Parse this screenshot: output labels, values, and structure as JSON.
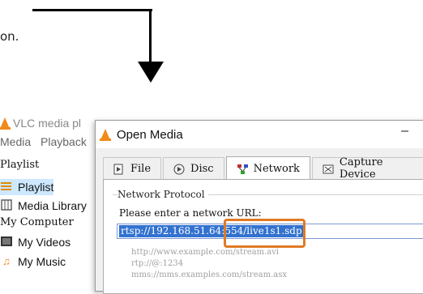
{
  "annotation": {
    "caption": "on."
  },
  "vlc_main": {
    "title": "VLC media pl",
    "menu": [
      "Media",
      "Playback"
    ],
    "playlist_heading": "Playlist",
    "items": [
      {
        "label": "Playlist",
        "icon": "playlist-icon"
      },
      {
        "label": "Media Library",
        "icon": "library-icon"
      }
    ],
    "computer_heading": "My Computer",
    "computer_items": [
      {
        "label": "My Videos",
        "icon": "videos-icon"
      },
      {
        "label": "My Music",
        "icon": "music-icon"
      }
    ]
  },
  "dialog": {
    "title": "Open Media",
    "minimize_glyph": "–",
    "tabs": [
      {
        "label": "File",
        "icon": "file-icon"
      },
      {
        "label": "Disc",
        "icon": "disc-icon"
      },
      {
        "label": "Network",
        "icon": "network-icon",
        "active": true
      },
      {
        "label": "Capture Device",
        "icon": "capture-icon"
      }
    ],
    "group_label": "Network Protocol",
    "url_label": "Please enter a network URL:",
    "url_value": "rtsp://192.168.51.64:554/live1s1.sdp",
    "examples": [
      "http://www.example.com/stream.avi",
      "rtp://@:1234",
      "mms://mms.examples.com/stream.asx"
    ]
  },
  "colors": {
    "highlight": "#e07a24",
    "selection": "#3272d0",
    "vlc_orange": "#f28a18"
  }
}
